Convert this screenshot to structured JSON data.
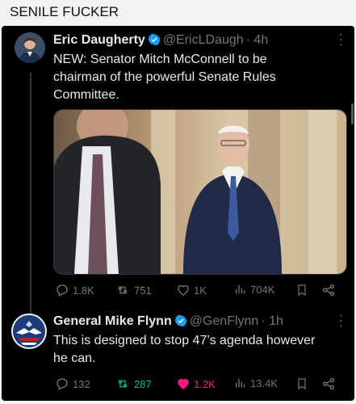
{
  "caption": "SENILE FUCKER",
  "colors": {
    "background": "#000000",
    "text": "#e7e9ea",
    "muted": "#71767b",
    "verified": "#1d9bf0",
    "retweet_active": "#00ba7c",
    "like_active": "#f91880"
  },
  "tweets": [
    {
      "name": "Eric Daugherty",
      "handle": "@EricLDaugh",
      "time": "· 4h",
      "text_lines": [
        "NEW: Senator Mitch McConnell to be",
        "chairman of the powerful Senate Rules",
        "Committee."
      ],
      "has_media": true,
      "stats": {
        "replies": "1.8K",
        "retweets": "751",
        "likes": "1K",
        "views": "704K"
      },
      "retweeted": false,
      "liked": false
    },
    {
      "name": "General Mike Flynn",
      "handle": "@GenFlynn",
      "time": "· 1h",
      "text_lines": [
        "This is designed to stop 47’s agenda however",
        "he can."
      ],
      "has_media": false,
      "stats": {
        "replies": "132",
        "retweets": "287",
        "likes": "1.2K",
        "views": "13.4K"
      },
      "retweeted": true,
      "liked": true
    }
  ],
  "icons": [
    "verified-badge-icon",
    "more-icon",
    "reply-icon",
    "retweet-icon",
    "like-icon",
    "views-icon",
    "bookmark-icon",
    "share-icon"
  ]
}
